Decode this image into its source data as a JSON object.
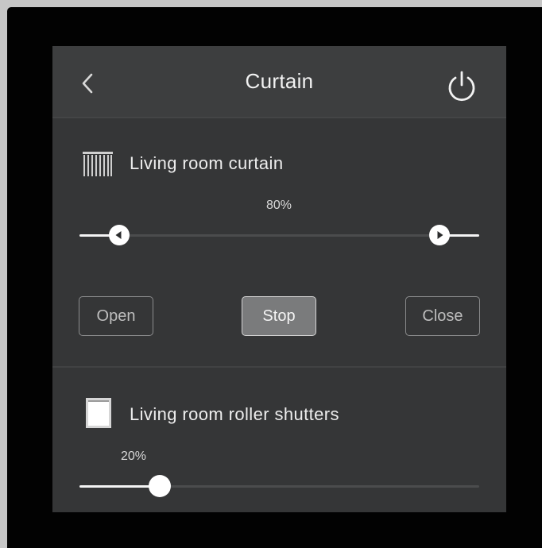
{
  "header": {
    "title": "Curtain",
    "back_icon": "chevron-left-icon",
    "power_icon": "power-icon"
  },
  "curtain": {
    "name": "Living room curtain",
    "icon": "curtain-icon",
    "percent_label": "80%",
    "level": 0.8,
    "buttons": {
      "open": "Open",
      "stop": "Stop",
      "close": "Close"
    },
    "active_button": "stop"
  },
  "shutters": {
    "name": "Living room roller shutters",
    "icon": "roller-shutter-icon",
    "percent_label": "20%",
    "level": 0.2
  },
  "colors": {
    "screen_background": "#353637",
    "header_background": "#3d3e3f",
    "accent": "#ffffff",
    "active_button_background": "#7a7b7c"
  }
}
